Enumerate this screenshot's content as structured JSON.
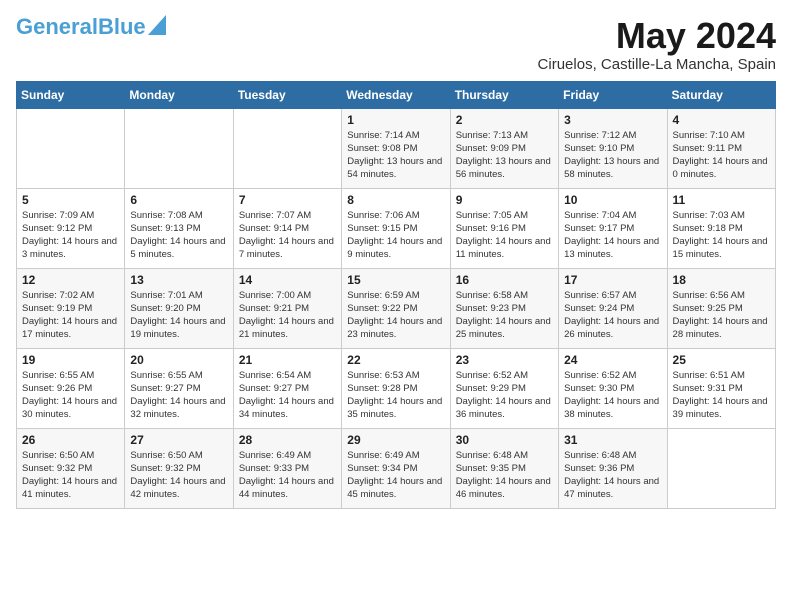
{
  "header": {
    "logo_general": "General",
    "logo_blue": "Blue",
    "month_title": "May 2024",
    "location": "Ciruelos, Castille-La Mancha, Spain"
  },
  "weekdays": [
    "Sunday",
    "Monday",
    "Tuesday",
    "Wednesday",
    "Thursday",
    "Friday",
    "Saturday"
  ],
  "weeks": [
    [
      {
        "day": "",
        "info": ""
      },
      {
        "day": "",
        "info": ""
      },
      {
        "day": "",
        "info": ""
      },
      {
        "day": "1",
        "info": "Sunrise: 7:14 AM\nSunset: 9:08 PM\nDaylight: 13 hours and 54 minutes."
      },
      {
        "day": "2",
        "info": "Sunrise: 7:13 AM\nSunset: 9:09 PM\nDaylight: 13 hours and 56 minutes."
      },
      {
        "day": "3",
        "info": "Sunrise: 7:12 AM\nSunset: 9:10 PM\nDaylight: 13 hours and 58 minutes."
      },
      {
        "day": "4",
        "info": "Sunrise: 7:10 AM\nSunset: 9:11 PM\nDaylight: 14 hours and 0 minutes."
      }
    ],
    [
      {
        "day": "5",
        "info": "Sunrise: 7:09 AM\nSunset: 9:12 PM\nDaylight: 14 hours and 3 minutes."
      },
      {
        "day": "6",
        "info": "Sunrise: 7:08 AM\nSunset: 9:13 PM\nDaylight: 14 hours and 5 minutes."
      },
      {
        "day": "7",
        "info": "Sunrise: 7:07 AM\nSunset: 9:14 PM\nDaylight: 14 hours and 7 minutes."
      },
      {
        "day": "8",
        "info": "Sunrise: 7:06 AM\nSunset: 9:15 PM\nDaylight: 14 hours and 9 minutes."
      },
      {
        "day": "9",
        "info": "Sunrise: 7:05 AM\nSunset: 9:16 PM\nDaylight: 14 hours and 11 minutes."
      },
      {
        "day": "10",
        "info": "Sunrise: 7:04 AM\nSunset: 9:17 PM\nDaylight: 14 hours and 13 minutes."
      },
      {
        "day": "11",
        "info": "Sunrise: 7:03 AM\nSunset: 9:18 PM\nDaylight: 14 hours and 15 minutes."
      }
    ],
    [
      {
        "day": "12",
        "info": "Sunrise: 7:02 AM\nSunset: 9:19 PM\nDaylight: 14 hours and 17 minutes."
      },
      {
        "day": "13",
        "info": "Sunrise: 7:01 AM\nSunset: 9:20 PM\nDaylight: 14 hours and 19 minutes."
      },
      {
        "day": "14",
        "info": "Sunrise: 7:00 AM\nSunset: 9:21 PM\nDaylight: 14 hours and 21 minutes."
      },
      {
        "day": "15",
        "info": "Sunrise: 6:59 AM\nSunset: 9:22 PM\nDaylight: 14 hours and 23 minutes."
      },
      {
        "day": "16",
        "info": "Sunrise: 6:58 AM\nSunset: 9:23 PM\nDaylight: 14 hours and 25 minutes."
      },
      {
        "day": "17",
        "info": "Sunrise: 6:57 AM\nSunset: 9:24 PM\nDaylight: 14 hours and 26 minutes."
      },
      {
        "day": "18",
        "info": "Sunrise: 6:56 AM\nSunset: 9:25 PM\nDaylight: 14 hours and 28 minutes."
      }
    ],
    [
      {
        "day": "19",
        "info": "Sunrise: 6:55 AM\nSunset: 9:26 PM\nDaylight: 14 hours and 30 minutes."
      },
      {
        "day": "20",
        "info": "Sunrise: 6:55 AM\nSunset: 9:27 PM\nDaylight: 14 hours and 32 minutes."
      },
      {
        "day": "21",
        "info": "Sunrise: 6:54 AM\nSunset: 9:27 PM\nDaylight: 14 hours and 34 minutes."
      },
      {
        "day": "22",
        "info": "Sunrise: 6:53 AM\nSunset: 9:28 PM\nDaylight: 14 hours and 35 minutes."
      },
      {
        "day": "23",
        "info": "Sunrise: 6:52 AM\nSunset: 9:29 PM\nDaylight: 14 hours and 36 minutes."
      },
      {
        "day": "24",
        "info": "Sunrise: 6:52 AM\nSunset: 9:30 PM\nDaylight: 14 hours and 38 minutes."
      },
      {
        "day": "25",
        "info": "Sunrise: 6:51 AM\nSunset: 9:31 PM\nDaylight: 14 hours and 39 minutes."
      }
    ],
    [
      {
        "day": "26",
        "info": "Sunrise: 6:50 AM\nSunset: 9:32 PM\nDaylight: 14 hours and 41 minutes."
      },
      {
        "day": "27",
        "info": "Sunrise: 6:50 AM\nSunset: 9:32 PM\nDaylight: 14 hours and 42 minutes."
      },
      {
        "day": "28",
        "info": "Sunrise: 6:49 AM\nSunset: 9:33 PM\nDaylight: 14 hours and 44 minutes."
      },
      {
        "day": "29",
        "info": "Sunrise: 6:49 AM\nSunset: 9:34 PM\nDaylight: 14 hours and 45 minutes."
      },
      {
        "day": "30",
        "info": "Sunrise: 6:48 AM\nSunset: 9:35 PM\nDaylight: 14 hours and 46 minutes."
      },
      {
        "day": "31",
        "info": "Sunrise: 6:48 AM\nSunset: 9:36 PM\nDaylight: 14 hours and 47 minutes."
      },
      {
        "day": "",
        "info": ""
      }
    ]
  ]
}
